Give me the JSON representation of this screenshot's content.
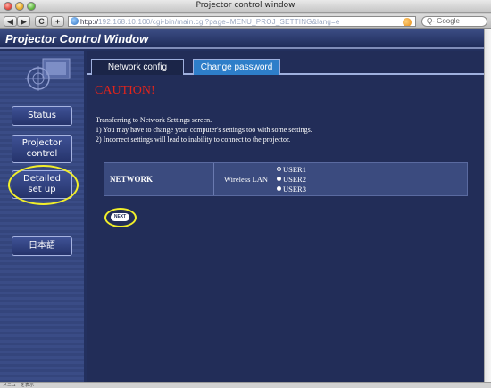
{
  "browser": {
    "window_title": "Projector control window",
    "url_host": "http://",
    "url_blurred": "192.168.10.100/cgi-bin/main.cgi?page=MENU_PROJ_SETTING&lang=e",
    "search_placeholder": "Q- Google",
    "back_glyph": "◀",
    "forward_glyph": "▶",
    "reload_glyph": "C",
    "add_glyph": "+",
    "status_text": "メニューを表示"
  },
  "page": {
    "title": "Projector Control Window"
  },
  "sidebar": {
    "items": [
      {
        "label": "Status"
      },
      {
        "label_line1": "Projector",
        "label_line2": "control"
      },
      {
        "label_line1": "Detailed",
        "label_line2": "set up"
      },
      {
        "label": "日本語"
      }
    ]
  },
  "tabs": [
    {
      "label": "Network config",
      "active": true
    },
    {
      "label": "Change password",
      "active": false
    }
  ],
  "main": {
    "caution": "CAUTION!",
    "line1": "Transferring to Network Settings screen.",
    "line2": "1)  You may have to change your computer's settings too with some settings.",
    "line3": "2)  Incorrect settings will lead to inability to connect to the projector.",
    "table": {
      "label": "NETWORK",
      "sublabel": "Wireless LAN",
      "options": [
        {
          "label": "USER1",
          "selected": true
        },
        {
          "label": "USER2",
          "selected": false
        },
        {
          "label": "USER3",
          "selected": false
        }
      ]
    },
    "next_label": "NEXT"
  },
  "colors": {
    "background": "#23305e",
    "caution_red": "#e2241b",
    "highlight_yellow": "#f1ee2a",
    "tab_active": "#2e7ec9"
  }
}
